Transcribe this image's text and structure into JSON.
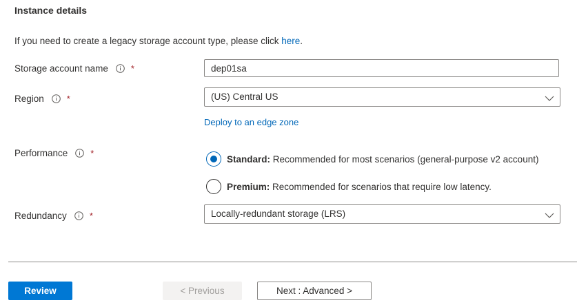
{
  "section": {
    "title": "Instance details"
  },
  "intro": {
    "text": "If you need to create a legacy storage account type, please click ",
    "link": "here",
    "suffix": "."
  },
  "fields": {
    "storage_account_name": {
      "label": "Storage account name",
      "required_marker": "*",
      "value": "dep01sa"
    },
    "region": {
      "label": "Region",
      "required_marker": "*",
      "value": "(US) Central US",
      "edge_zone_link": "Deploy to an edge zone"
    },
    "performance": {
      "label": "Performance",
      "required_marker": "*",
      "options": [
        {
          "title": "Standard:",
          "description": " Recommended for most scenarios (general-purpose v2 account)",
          "selected": true
        },
        {
          "title": "Premium:",
          "description": " Recommended for scenarios that require low latency.",
          "selected": false
        }
      ]
    },
    "redundancy": {
      "label": "Redundancy",
      "required_marker": "*",
      "value": "Locally-redundant storage (LRS)"
    }
  },
  "footer": {
    "review_label": "Review",
    "previous_label": "< Previous",
    "next_label": "Next : Advanced >"
  },
  "icons": {
    "info": "info-icon",
    "chevron": "chevron-down-icon"
  },
  "colors": {
    "accent": "#0078d4",
    "link": "#0067b8",
    "required": "#a4262c",
    "text": "#323130",
    "border": "#8a8886",
    "disabled_bg": "#f3f2f1",
    "disabled_text": "#a19f9d"
  }
}
